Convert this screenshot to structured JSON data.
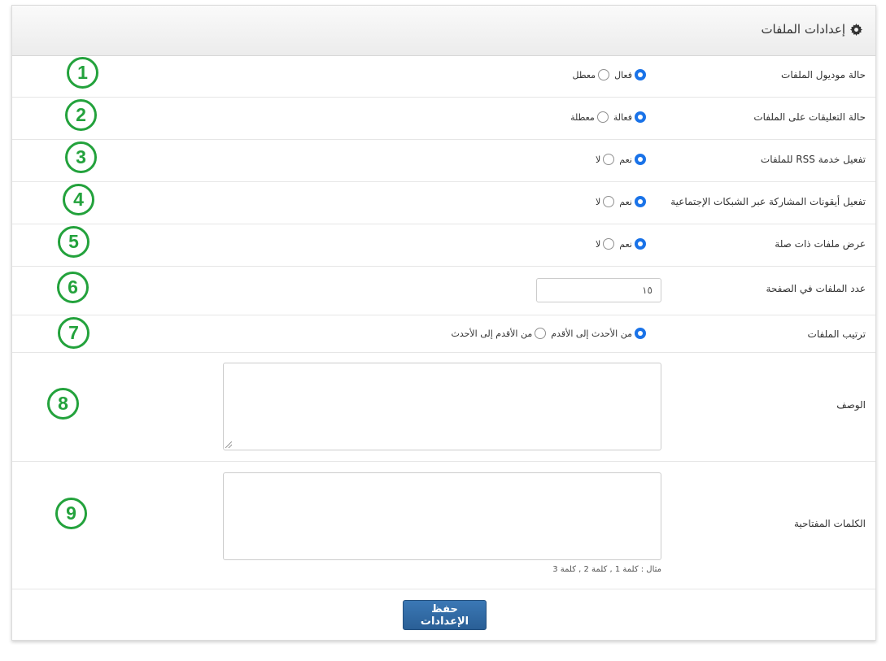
{
  "panel": {
    "title": "إعدادات الملفات",
    "title_icon": "gear-icon"
  },
  "rows": [
    {
      "label": "حالة موديول الملفات",
      "marker": "1",
      "options": [
        "فعال",
        "معطل"
      ],
      "selected": 0
    },
    {
      "label": "حالة التعليقات على الملفات",
      "marker": "2",
      "options": [
        "فعالة",
        "معطلة"
      ],
      "selected": 0
    },
    {
      "label": "تفعيل خدمة RSS للملفات",
      "marker": "3",
      "options": [
        "نعم",
        "لا"
      ],
      "selected": 0
    },
    {
      "label": "تفعيل أيقونات المشاركة عبر الشبكات الإجتماعية",
      "marker": "4",
      "options": [
        "نعم",
        "لا"
      ],
      "selected": 0
    },
    {
      "label": "عرض ملفات ذات صلة",
      "marker": "5",
      "options": [
        "نعم",
        "لا"
      ],
      "selected": 0
    },
    {
      "label": "عدد الملفات في الصفحة",
      "marker": "6",
      "value": "١٥"
    },
    {
      "label": "ترتيب الملفات",
      "marker": "7",
      "options": [
        "من الأحدث إلى الأقدم",
        "من الأقدم إلى الأحدث"
      ],
      "selected": 0
    },
    {
      "label": "الوصف",
      "marker": "8",
      "value": ""
    },
    {
      "label": "الكلمات المفتاحية",
      "marker": "9",
      "value": "",
      "help": "مثال : كلمة 1 , كلمة 2 , كلمة 3"
    }
  ],
  "actions": {
    "save_label": "حفظ الإعدادات"
  },
  "colors": {
    "marker_green": "#23a23c",
    "radio_blue": "#1a73e8",
    "button_blue": "#2f6aa6"
  }
}
